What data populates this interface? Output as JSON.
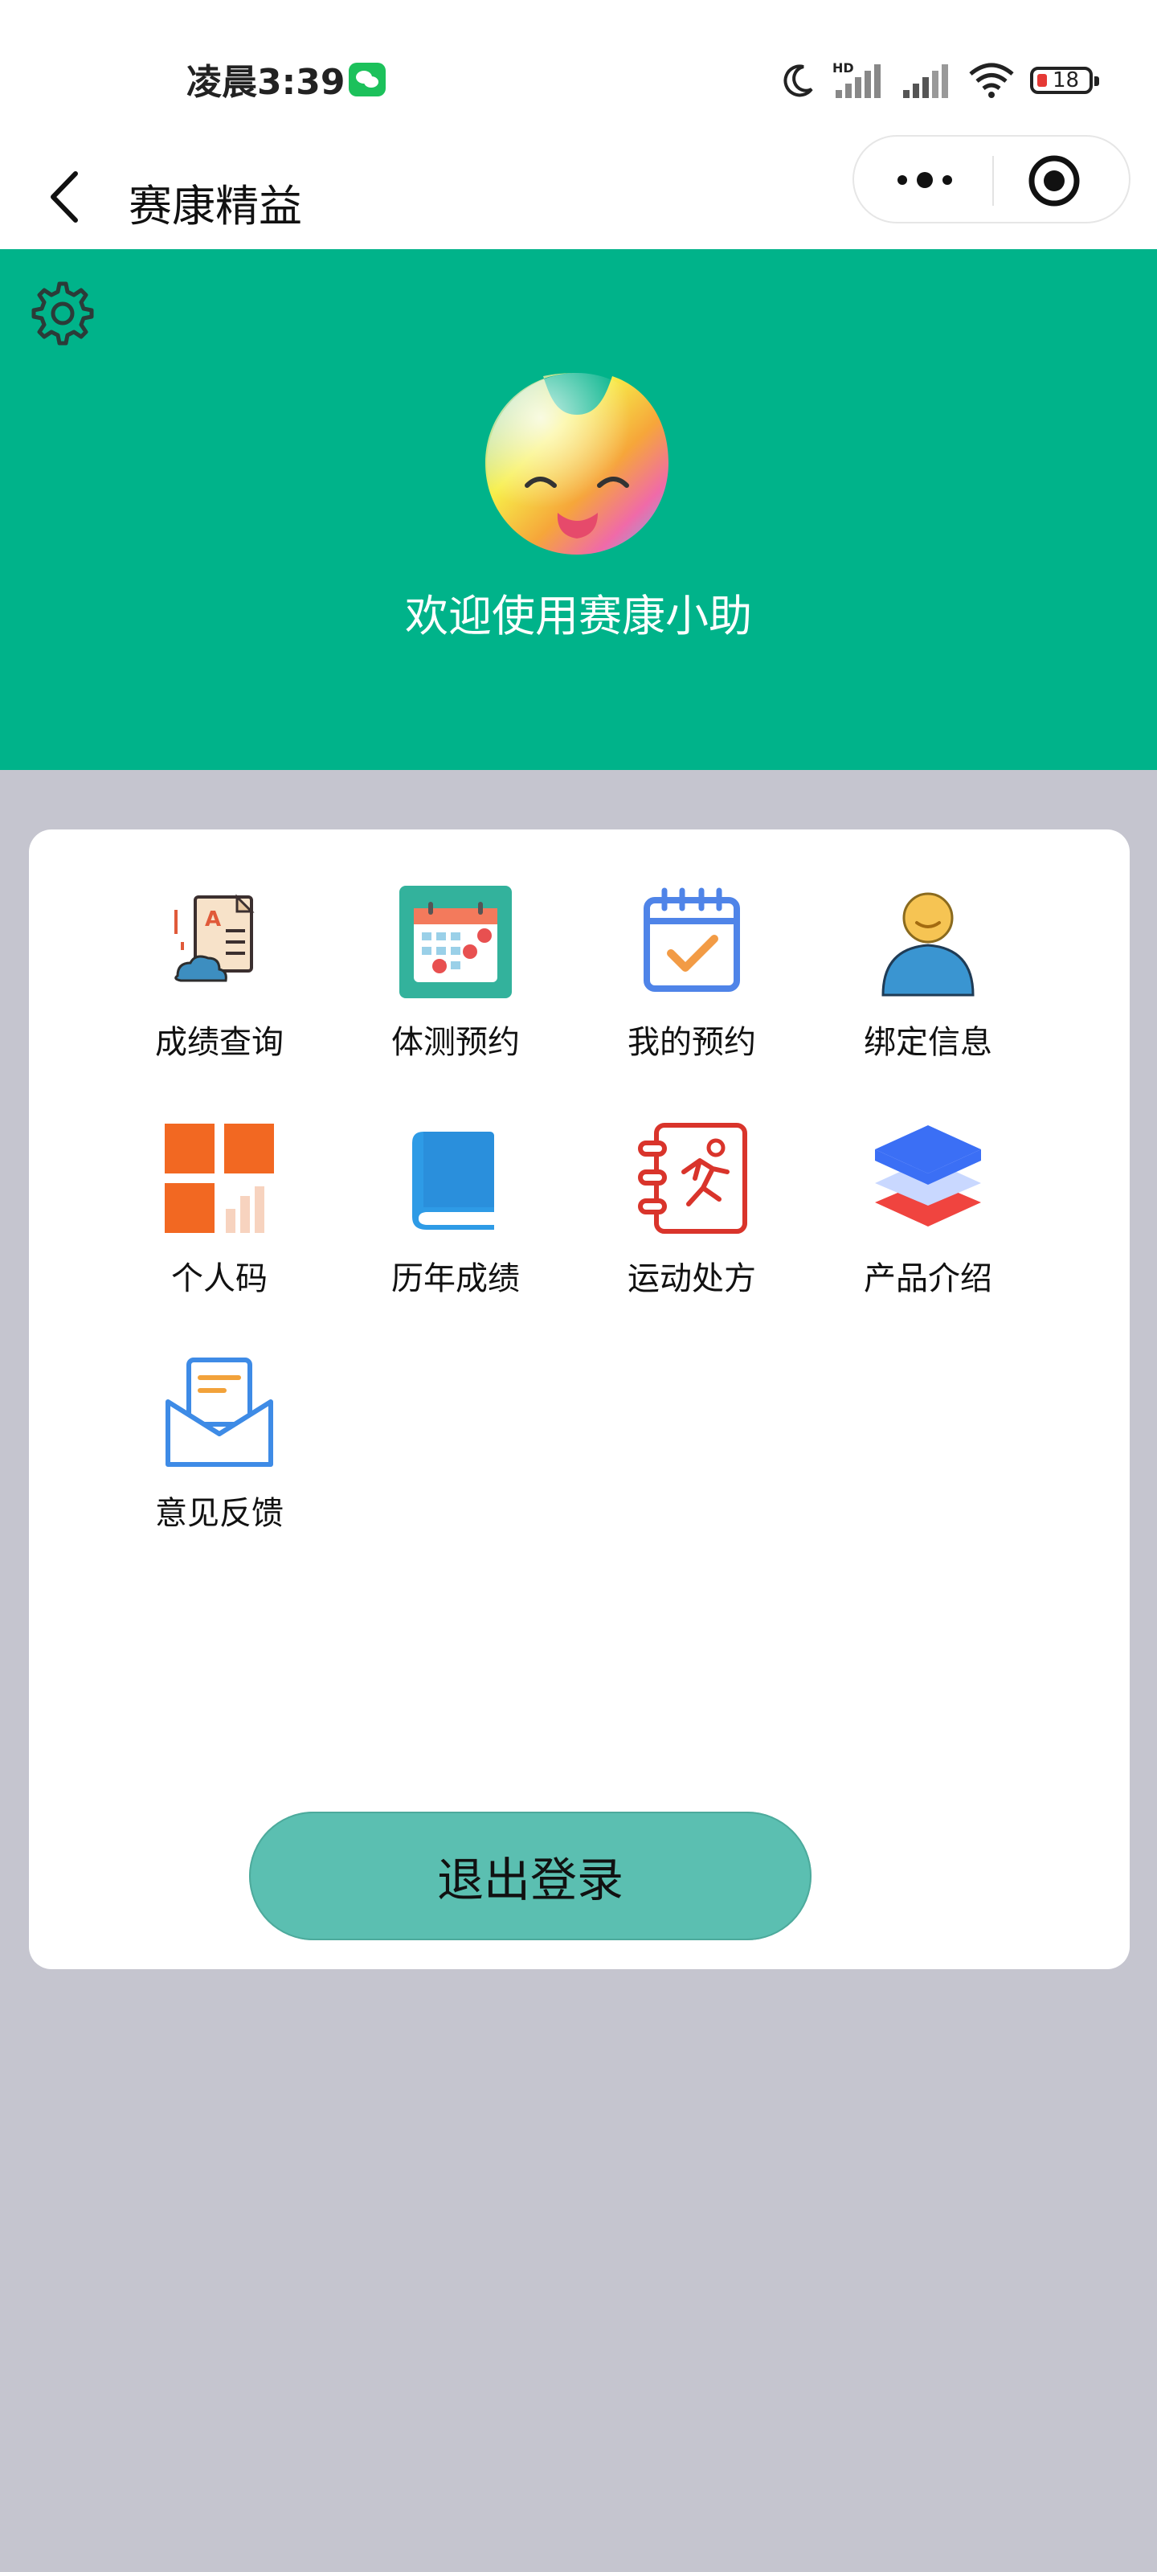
{
  "status_bar": {
    "time": "凌晨3:39",
    "battery_level": "18",
    "network_badge": "HD"
  },
  "header": {
    "title": "赛康精益",
    "icons": [
      "chevron-left-icon",
      "more-dots-icon",
      "mini-program-close-icon"
    ]
  },
  "banner": {
    "welcome": "欢迎使用赛康小助",
    "background_color": "#00b38a",
    "icons": [
      "gear-icon",
      "mascot-avatar"
    ]
  },
  "menu": {
    "items": [
      {
        "label": "成绩查询",
        "icon": "score-report-icon"
      },
      {
        "label": "体测预约",
        "icon": "calendar-booking-icon"
      },
      {
        "label": "我的预约",
        "icon": "calendar-check-icon"
      },
      {
        "label": "绑定信息",
        "icon": "user-profile-icon"
      },
      {
        "label": "个人码",
        "icon": "personal-code-icon"
      },
      {
        "label": "历年成绩",
        "icon": "book-icon"
      },
      {
        "label": "运动处方",
        "icon": "exercise-prescription-icon"
      },
      {
        "label": "产品介绍",
        "icon": "layers-icon"
      },
      {
        "label": "意见反馈",
        "icon": "feedback-envelope-icon"
      }
    ]
  },
  "logout": {
    "label": "退出登录",
    "color": "#5bbfb1"
  },
  "page_background": "#c5c5cf"
}
